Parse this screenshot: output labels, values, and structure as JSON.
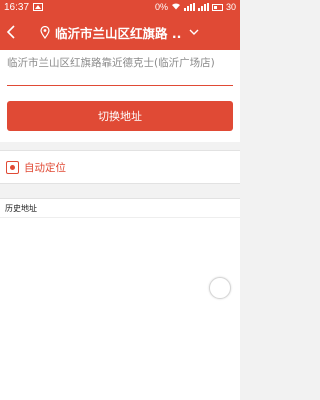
{
  "status_bar": {
    "time": "16:37",
    "battery_percent": "0%",
    "battery_level": "30"
  },
  "header": {
    "location_title": "临沂市兰山区红旗路 ..",
    "icons": [
      "back-arrow-icon",
      "location-pin-icon",
      "chevron-down-icon"
    ]
  },
  "address_box": {
    "value": "临沂市兰山区红旗路靠近德克士(临沂广场店)"
  },
  "switch_button": {
    "label": "切换地址"
  },
  "auto_locate": {
    "label": "自动定位",
    "icon": "locate-target-icon"
  },
  "history": {
    "header_label": "历史地址",
    "items": []
  },
  "colors": {
    "accent": "#e04a35",
    "background": "#f2f2f2"
  }
}
